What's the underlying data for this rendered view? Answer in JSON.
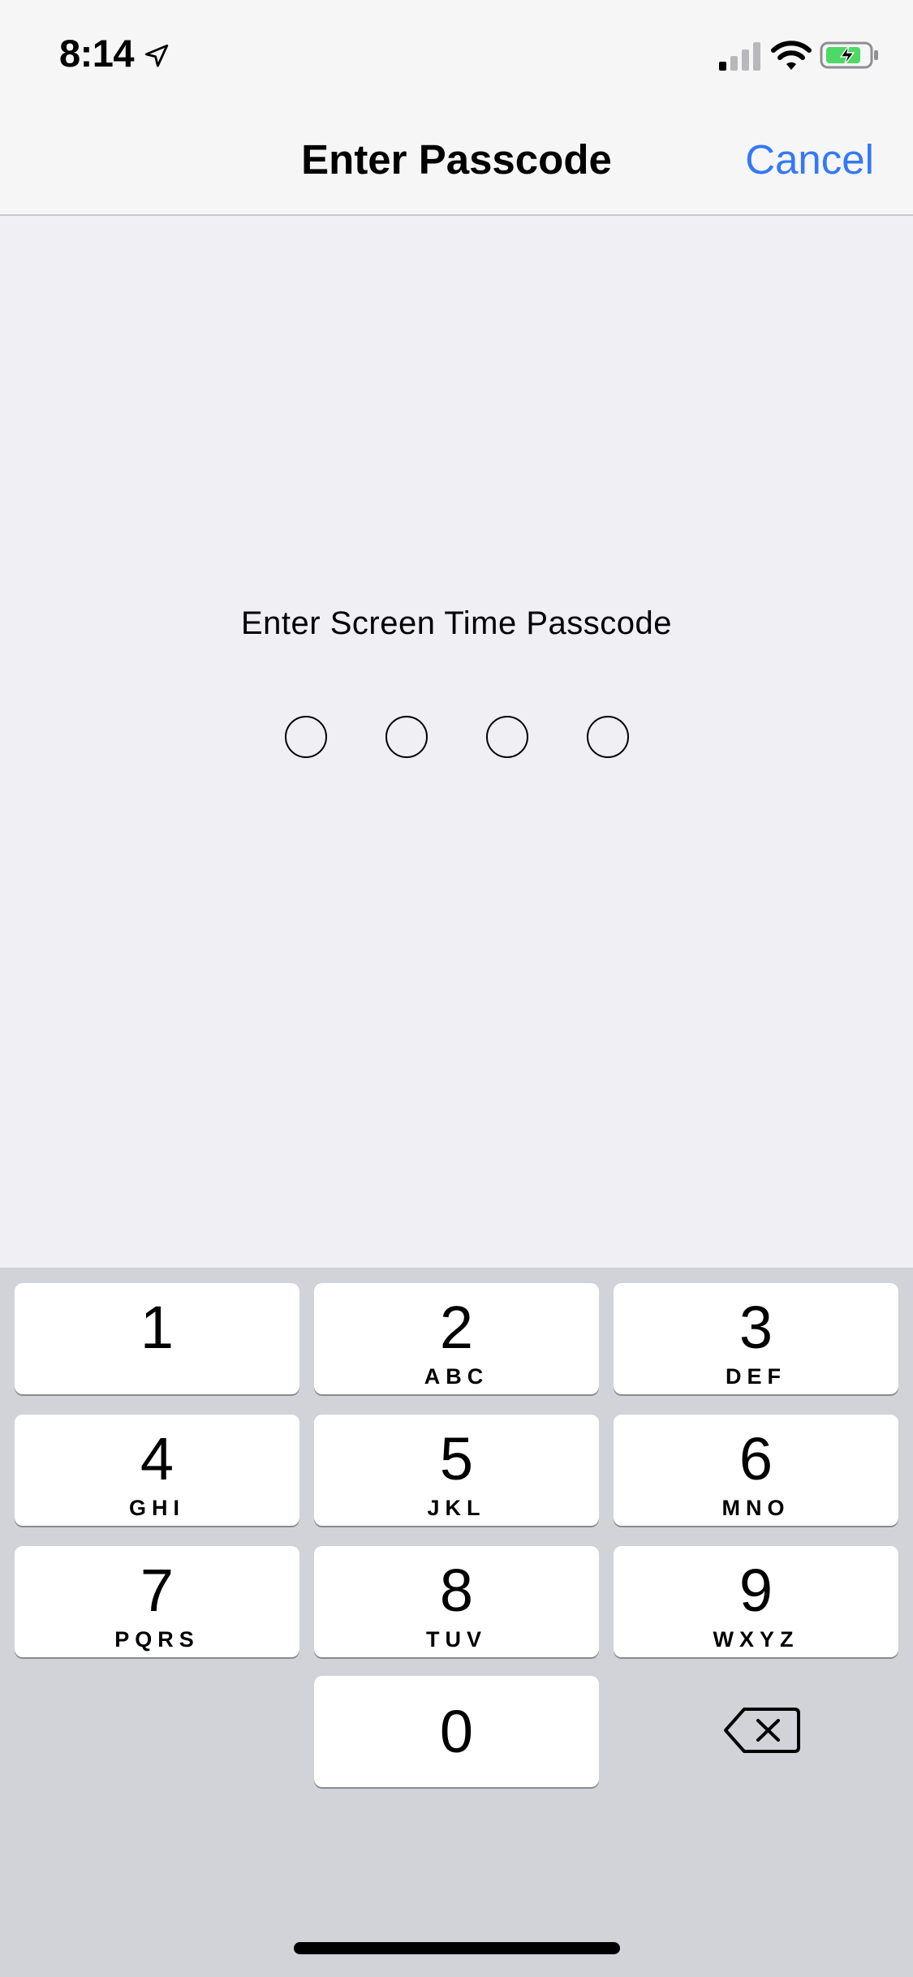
{
  "status_bar": {
    "time": "8:14",
    "icons": [
      "location-arrow-icon",
      "cellular-signal-icon",
      "wifi-icon",
      "battery-charging-icon"
    ],
    "battery_color": "#4cd964"
  },
  "nav": {
    "title": "Enter Passcode",
    "cancel_label": "Cancel",
    "accent_color": "#3478f6"
  },
  "prompt": {
    "label": "Enter Screen Time Passcode",
    "digits_total": 4,
    "digits_entered": 0
  },
  "keypad": {
    "keys": [
      {
        "digit": "1",
        "letters": ""
      },
      {
        "digit": "2",
        "letters": "ABC"
      },
      {
        "digit": "3",
        "letters": "DEF"
      },
      {
        "digit": "4",
        "letters": "GHI"
      },
      {
        "digit": "5",
        "letters": "JKL"
      },
      {
        "digit": "6",
        "letters": "MNO"
      },
      {
        "digit": "7",
        "letters": "PQRS"
      },
      {
        "digit": "8",
        "letters": "TUV"
      },
      {
        "digit": "9",
        "letters": "WXYZ"
      },
      {
        "digit": "0",
        "letters": ""
      }
    ],
    "delete_icon": "backspace-icon"
  }
}
